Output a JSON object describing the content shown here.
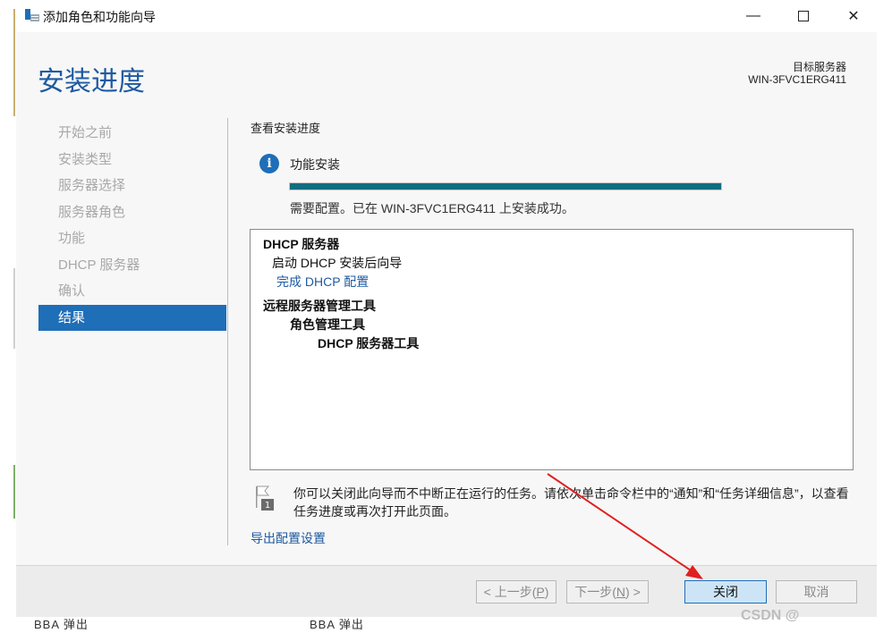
{
  "window": {
    "title": "添加角色和功能向导",
    "min_symbol": "—",
    "close_symbol": "✕"
  },
  "header": {
    "page_title": "安装进度",
    "target_label": "目标服务器",
    "target_name": "WIN-3FVC1ERG411"
  },
  "nav": {
    "items": [
      {
        "label": "开始之前",
        "active": false
      },
      {
        "label": "安装类型",
        "active": false
      },
      {
        "label": "服务器选择",
        "active": false
      },
      {
        "label": "服务器角色",
        "active": false
      },
      {
        "label": "功能",
        "active": false
      },
      {
        "label": "DHCP 服务器",
        "active": false
      },
      {
        "label": "确认",
        "active": false
      },
      {
        "label": "结果",
        "active": true
      }
    ]
  },
  "main": {
    "section_heading": "查看安装进度",
    "feature_label": "功能安装",
    "info_icon_glyph": "i",
    "progress_fraction": 1.0,
    "status_text": "需要配置。已在 WIN-3FVC1ERG411 上安装成功。",
    "results": {
      "dhcp_server": "DHCP 服务器",
      "launch_wizard": "启动 DHCP 安装后向导",
      "complete_config_link": "完成 DHCP 配置",
      "rsat": "远程服务器管理工具",
      "role_tools": "角色管理工具",
      "dhcp_tools": "DHCP 服务器工具"
    },
    "notice": "你可以关闭此向导而不中断正在运行的任务。请依次单击命令栏中的“通知”和“任务详细信息”，以查看任务进度或再次打开此页面。",
    "flag_badge": "1",
    "export_link": "导出配置设置"
  },
  "footer": {
    "prev_prefix": "< 上一步(",
    "prev_key": "P",
    "prev_suffix": ")",
    "next_prefix": "下一步(",
    "next_key": "N",
    "next_suffix": ") >",
    "close_label": "关闭",
    "cancel_label": "取消"
  },
  "background": {
    "bottom_text_left": "BBA 弹出",
    "bottom_text_right": "BBA 弹出",
    "watermark": "CSDN @"
  },
  "colors": {
    "accent": "#1e6eb8",
    "title_blue": "#1e5aa0",
    "progress_teal": "#0f6e80",
    "arrow_red": "#e02020"
  }
}
